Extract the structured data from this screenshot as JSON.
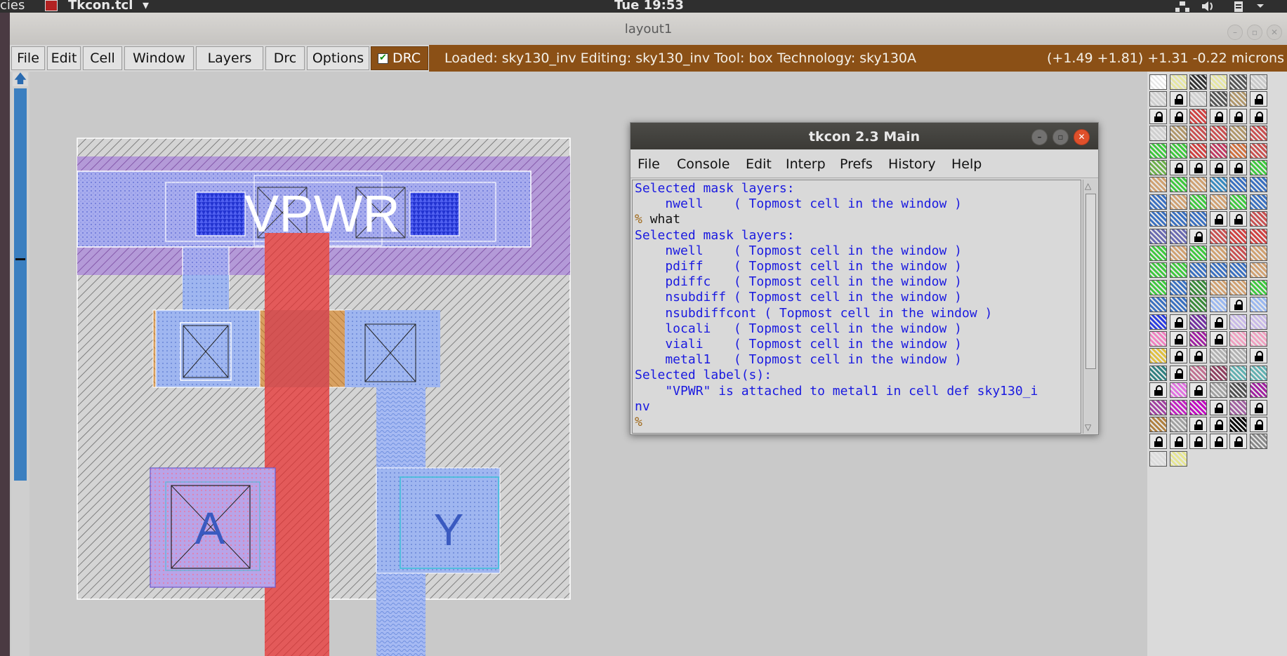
{
  "system_bar": {
    "left_label": "cies",
    "app_menu": "Tkcon.tcl",
    "app_menu_arrow": "▾",
    "clock": "Tue 19:53"
  },
  "window": {
    "title": "layout1"
  },
  "menubar": {
    "items": [
      "File",
      "Edit",
      "Cell",
      "Window",
      "Layers",
      "Drc",
      "Options"
    ],
    "drc_label": "DRC",
    "drc_checked": true
  },
  "status": {
    "info": "Loaded: sky130_inv Editing: sky130_inv Tool: box  Technology: sky130A",
    "coords": "(+1.49 +1.81) +1.31 -0.22 microns"
  },
  "layout": {
    "labels": {
      "power": "VPWR",
      "input": "A",
      "output": "Y"
    },
    "colors": {
      "metal1": "#a9b0f0",
      "poly": "#e05858",
      "diff": "#d09a5a",
      "background_hatch": "#8a8a8a"
    }
  },
  "tkcon": {
    "title": "tkcon 2.3 Main",
    "menu": [
      "File",
      "Console",
      "Edit",
      "Interp",
      "Prefs",
      "History",
      "Help"
    ],
    "lines": [
      {
        "t": "Selected mask layers:",
        "c": ""
      },
      {
        "t": "    nwell    ( Topmost cell in the window )",
        "c": ""
      },
      {
        "t": "% ",
        "c": "p",
        "extra": "what"
      },
      {
        "t": "Selected mask layers:",
        "c": ""
      },
      {
        "t": "    nwell    ( Topmost cell in the window )",
        "c": ""
      },
      {
        "t": "    pdiff    ( Topmost cell in the window )",
        "c": ""
      },
      {
        "t": "    pdiffc   ( Topmost cell in the window )",
        "c": ""
      },
      {
        "t": "    nsubdiff ( Topmost cell in the window )",
        "c": ""
      },
      {
        "t": "    nsubdiffcont ( Topmost cell in the window )",
        "c": ""
      },
      {
        "t": "    locali   ( Topmost cell in the window )",
        "c": ""
      },
      {
        "t": "    viali    ( Topmost cell in the window )",
        "c": ""
      },
      {
        "t": "    metal1   ( Topmost cell in the window )",
        "c": ""
      },
      {
        "t": "Selected label(s):",
        "c": ""
      },
      {
        "t": "    \"VPWR\" is attached to metal1 in cell def sky130_i",
        "c": ""
      },
      {
        "t": "nv",
        "c": ""
      },
      {
        "t": "%",
        "c": "p"
      }
    ]
  },
  "palette": {
    "colors": [
      "#ffffff",
      "#e6e6a0",
      "#333333",
      "#e6e6a0",
      "#555555",
      "#c8c8c8",
      "#cfcfcf",
      "#111111",
      "#cfcfcf",
      "#555555",
      "#b0966a",
      "#111111",
      "#111111",
      "#111111",
      "#d04040",
      "#111111",
      "#111111",
      "#111111",
      "#cfcfcf",
      "#b0966a",
      "#c85050",
      "#c85050",
      "#b0966a",
      "#c85050",
      "#3ec83e",
      "#3ec83e",
      "#d04040",
      "#c03a60",
      "#d07040",
      "#c85050",
      "#6cb04a",
      "#111111",
      "#111111",
      "#111111",
      "#111111",
      "#3ec83e",
      "#d0a070",
      "#3ec83e",
      "#d0a070",
      "#3a8ac0",
      "#3a70c0",
      "#3a70c0",
      "#3a70c0",
      "#d0a070",
      "#3ec83e",
      "#d0a070",
      "#3ec83e",
      "#3a70c0",
      "#3a70c0",
      "#3a70c0",
      "#3a70c0",
      "#111111",
      "#111111",
      "#c85050",
      "#6a6ab0",
      "#6a6ab0",
      "#111111",
      "#c85050",
      "#d04040",
      "#d04040",
      "#3ec83e",
      "#d0a070",
      "#3ec83e",
      "#d0a070",
      "#c85050",
      "#d0a070",
      "#3ec83e",
      "#3ec83e",
      "#3a70c0",
      "#3a70c0",
      "#3a70c0",
      "#d0a070",
      "#3ec83e",
      "#3a70c0",
      "#3a8a3a",
      "#d0a070",
      "#d0a070",
      "#3ec83e",
      "#3a70c0",
      "#3a70c0",
      "#3a8a3a",
      "#9ab8f0",
      "#111111",
      "#9ab8f0",
      "#2a3ae0",
      "#111111",
      "#7030a0",
      "#111111",
      "#c8b8e8",
      "#c8b8e8",
      "#f080c0",
      "#111111",
      "#a020a0",
      "#111111",
      "#f0a0c0",
      "#f0a0c0",
      "#e0c040",
      "#111111",
      "#111111",
      "#b0b0b0",
      "#b0b0b0",
      "#111111",
      "#308080",
      "#111111",
      "#c07090",
      "#904060",
      "#60b0b0",
      "#60b0b0",
      "#111111",
      "#e070e0",
      "#111111",
      "#a0a0a0",
      "#505050",
      "#a020a0",
      "#a040a0",
      "#c020c0",
      "#c000c0",
      "#111111",
      "#a060a0",
      "#111111",
      "#b08040",
      "#a0a0a0",
      "#111111",
      "#111111",
      "#000000",
      "#111111",
      "#111111",
      "#111111",
      "#111111",
      "#111111",
      "#111111",
      "#888888",
      "#dcdcdc",
      "#e6e690"
    ]
  }
}
